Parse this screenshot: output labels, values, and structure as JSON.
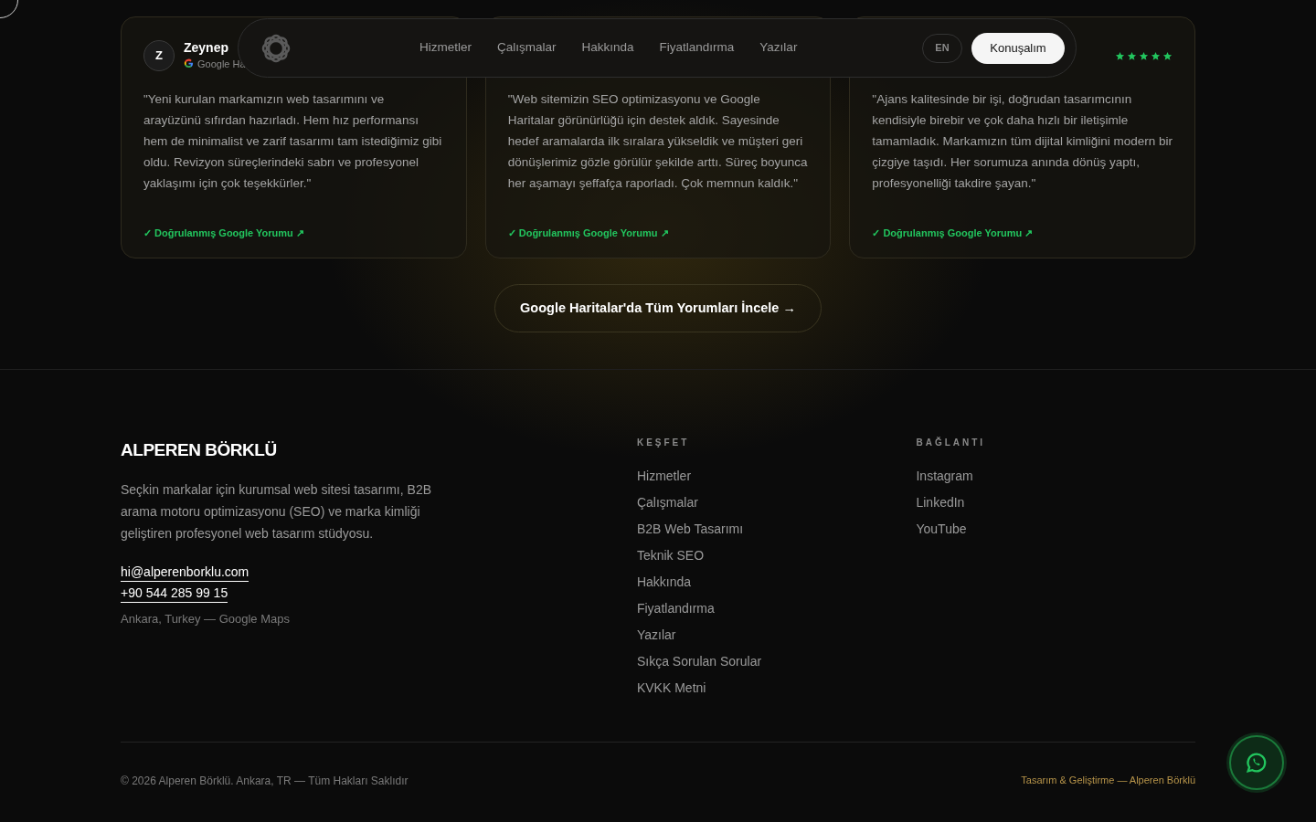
{
  "nav": {
    "links": [
      "Hizmetler",
      "Çalışmalar",
      "Hakkında",
      "Fiyatlandırma",
      "Yazılar"
    ],
    "language": "EN",
    "cta": "Konuşalım"
  },
  "reviews": [
    {
      "initial": "Z",
      "name": "Zeynep",
      "source": "Google Ha",
      "text": "\"Yeni kurulan markamızın web tasarımını ve arayüzünü sıfırdan hazırladı. Hem hız performansı hem de minimalist ve zarif tasarımı tam istediğimiz gibi oldu. Revizyon süreçlerindeki sabrı ve profesyonel yaklaşımı için çok teşekkürler.\"",
      "verified": "✓ Doğrulanmış Google Yorumu ↗"
    },
    {
      "text": "\"Web sitemizin SEO optimizasyonu ve Google Haritalar görünürlüğü için destek aldık. Sayesinde hedef aramalarda ilk sıralara yükseldik ve müşteri geri dönüşlerimiz gözle görülür şekilde arttı. Süreç boyunca her aşamayı şeffafça raporladı. Çok memnun kaldık.\"",
      "verified": "✓ Doğrulanmış Google Yorumu ↗"
    },
    {
      "stars": 5,
      "text": "\"Ajans kalitesinde bir işi, doğrudan tasarımcının kendisiyle birebir ve çok daha hızlı bir iletişimle tamamladık. Markamızın tüm dijital kimliğini modern bir çizgiye taşıdı. Her sorumuza anında dönüş yaptı, profesyonelliği takdire şayan.\"",
      "verified": "✓ Doğrulanmış Google Yorumu ↗"
    }
  ],
  "all_reviews_button": "Google Haritalar'da Tüm Yorumları İncele →",
  "footer": {
    "brand": "ALPEREN BÖRKLÜ",
    "description": "Seçkin markalar için kurumsal web sitesi tasarımı, B2B arama motoru optimizasyonu (SEO) ve marka kimliği geliştiren profesyonel web tasarım stüdyosu.",
    "email": "hi@alperenborklu.com",
    "phone": "+90 544 285 99 15",
    "location": "Ankara, Turkey — Google Maps",
    "columns": [
      {
        "title": "KEŞFET",
        "links": [
          "Hizmetler",
          "Çalışmalar",
          "B2B Web Tasarımı",
          "Teknik SEO",
          "Hakkında",
          "Fiyatlandırma",
          "Yazılar",
          "Sıkça Sorulan Sorular",
          "KVKK Metni"
        ]
      },
      {
        "title": "BAĞLANTI",
        "links": [
          "Instagram",
          "LinkedIn",
          "YouTube"
        ]
      }
    ],
    "copyright": "© 2026 Alperen Börklü. Ankara, TR — Tüm Hakları Saklıdır",
    "credit": "Tasarım & Geliştirme — Alperen Börklü"
  }
}
